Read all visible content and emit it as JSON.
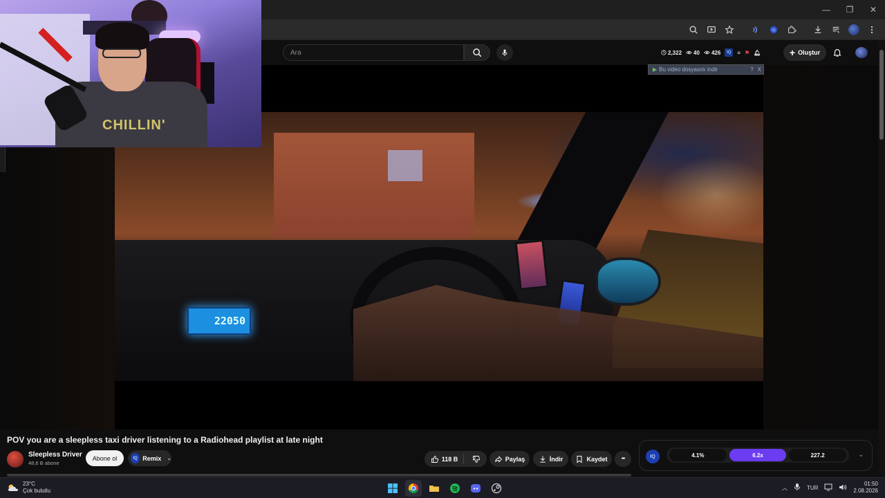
{
  "window": {
    "minimize_glyph": "—",
    "restore_glyph": "❐",
    "close_glyph": "✕"
  },
  "youtube": {
    "search_placeholder": "Ara",
    "stats": {
      "time": "2,322",
      "views": "40",
      "watching": "426"
    },
    "create_label": "Oluştur"
  },
  "download_helper": {
    "label": "Bu video dosyasını indir",
    "help": "?",
    "close": "X"
  },
  "video": {
    "meter_reading": "22050",
    "shirt_text": "CHILLIN'"
  },
  "info": {
    "title": "POV you are a sleepless taxi driver listening to a Radiohead playlist at late night",
    "channel_name": "Sleepless Driver",
    "subscribers": "48,6 B abone",
    "subscribe_label": "Abone ol",
    "remix_label": "Remix",
    "like_count": "118 B",
    "share_label": "Paylaş",
    "download_label": "İndir",
    "save_label": "Kaydet",
    "more_label": "•••"
  },
  "iq_panel": {
    "badge": "IQ",
    "stats": [
      "4.1%",
      "6.2x",
      "227.2"
    ],
    "active_index": 1
  },
  "taskbar": {
    "temperature": "23°C",
    "weather": "Çok bulutlu",
    "language": "TUR",
    "time": "01:50",
    "date": "2.08.2026"
  },
  "colors": {
    "accent_purple": "#6b3cf0",
    "iq_blue": "#1d3fb0",
    "background": "#0f0f0f"
  }
}
